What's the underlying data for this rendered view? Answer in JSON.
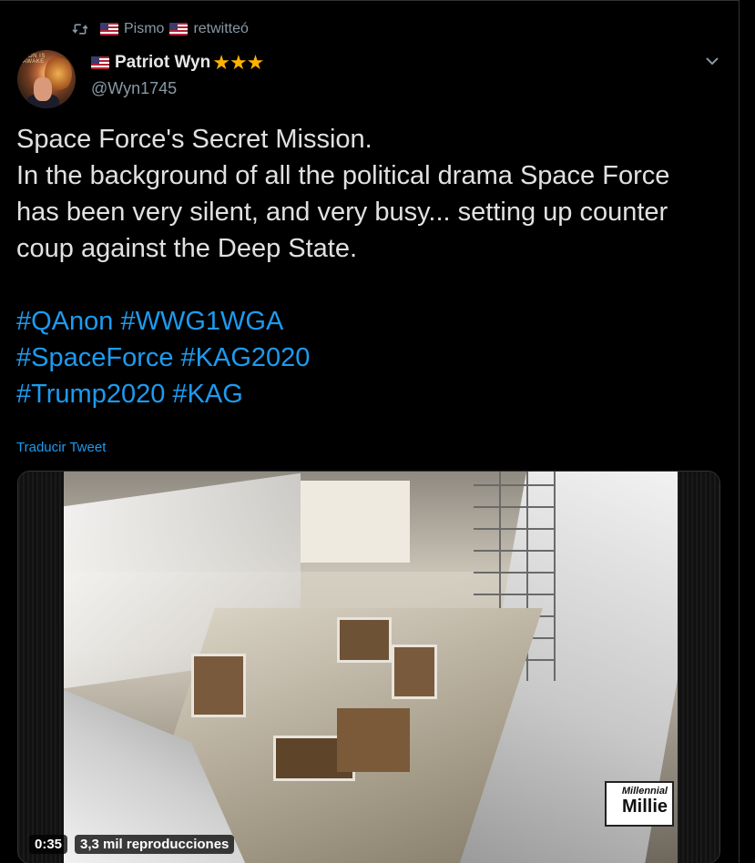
{
  "retweet": {
    "user": "Pismo",
    "action": "retwitteó"
  },
  "author": {
    "display_name": "Patriot Wyn",
    "stars": "★★★",
    "handle": "@Wyn1745",
    "avatar_text": "LION IS AWAKE"
  },
  "tweet": {
    "lines": [
      "Space Force's Secret Mission.",
      "In the background of all the political drama Space Force",
      "has been very silent, and very busy... setting up counter",
      "coup against the Deep State."
    ],
    "hashtag_lines": [
      "#QAnon #WWG1WGA",
      "#SpaceForce #KAG2020",
      "#Trump2020 #KAG"
    ],
    "translate_label": "Traducir Tweet"
  },
  "video": {
    "duration": "0:35",
    "views": "3,3 mil reproducciones",
    "watermark_line1": "Millennial",
    "watermark_line2": "Millie"
  },
  "icons": [
    "retweet-icon",
    "us-flag-icon",
    "chevron-down-icon"
  ],
  "colors": {
    "background": "#000000",
    "link": "#1d9bf0",
    "secondary_text": "#8899a6",
    "stars": "#ffb300"
  }
}
